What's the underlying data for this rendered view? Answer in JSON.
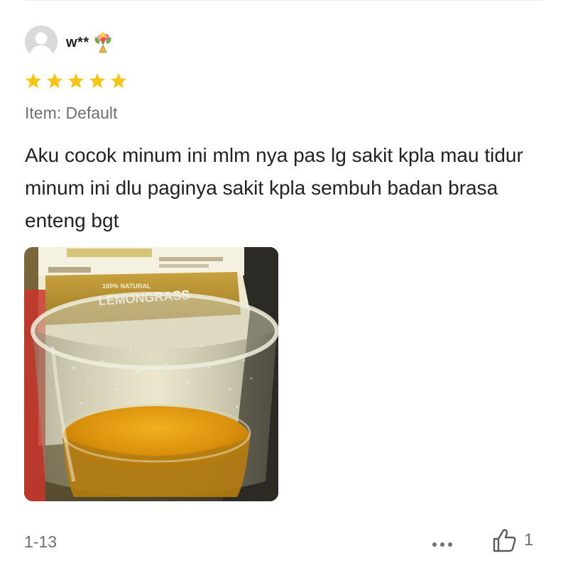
{
  "review": {
    "username": "w**",
    "rating": 5,
    "variant_label": "Item: Default",
    "text": "Aku cocok minum ini mlm nya pas lg sakit kpla mau tidur minum ini dlu paginya sakit kpla sembuh badan brasa enteng bgt",
    "date": "1-13",
    "like_count": "1"
  },
  "photo": {
    "package_text": "LEMONGRASS",
    "package_subtext": "100% NATURAL"
  },
  "colors": {
    "star": "#f5c518",
    "secondary_text": "#6f6f6f",
    "primary_text": "#222222",
    "avatar_bg": "#d9d9d9"
  },
  "icons": {
    "avatar": "default-avatar-icon",
    "username_badge": "flower-bouquet-icon",
    "star": "star-icon",
    "more": "more-dots-icon",
    "like": "thumbs-up-icon"
  }
}
